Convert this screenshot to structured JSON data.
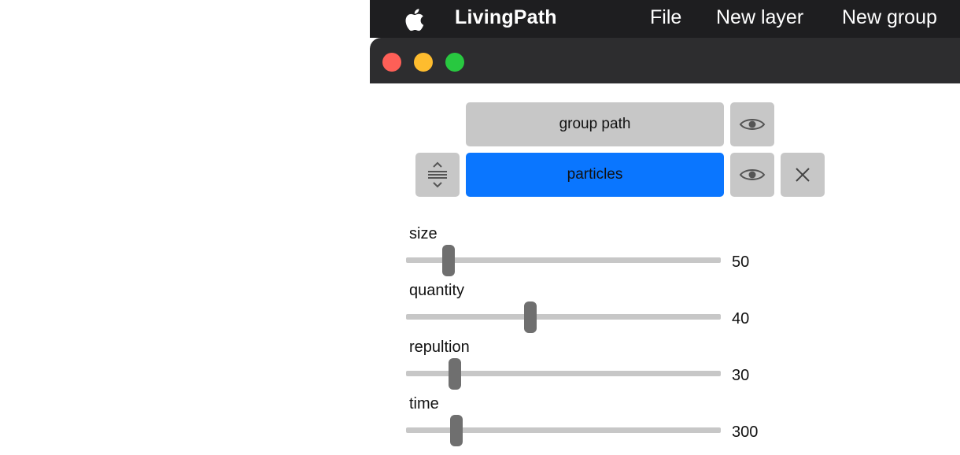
{
  "menubar": {
    "app_icon": "apple-icon",
    "app_name": "LivingPath",
    "items": [
      "File",
      "New layer",
      "New group"
    ]
  },
  "window": {
    "controls": {
      "close_color": "#fe5f57",
      "minimize_color": "#febc2e",
      "zoom_color": "#28c840"
    }
  },
  "layers": {
    "group": {
      "label": "group path",
      "visibility_icon": "eye-icon"
    },
    "selected": {
      "label": "particles",
      "drag_icon": "reorder-handle-icon",
      "visibility_icon": "eye-icon",
      "delete_icon": "close-x-icon",
      "color": "#0a76ff"
    }
  },
  "params": [
    {
      "label": "size",
      "value": "50",
      "fraction": 0.135
    },
    {
      "label": "quantity",
      "value": "40",
      "fraction": 0.395
    },
    {
      "label": "repultion",
      "value": "30",
      "fraction": 0.155
    },
    {
      "label": "time",
      "value": "300",
      "fraction": 0.16
    }
  ]
}
